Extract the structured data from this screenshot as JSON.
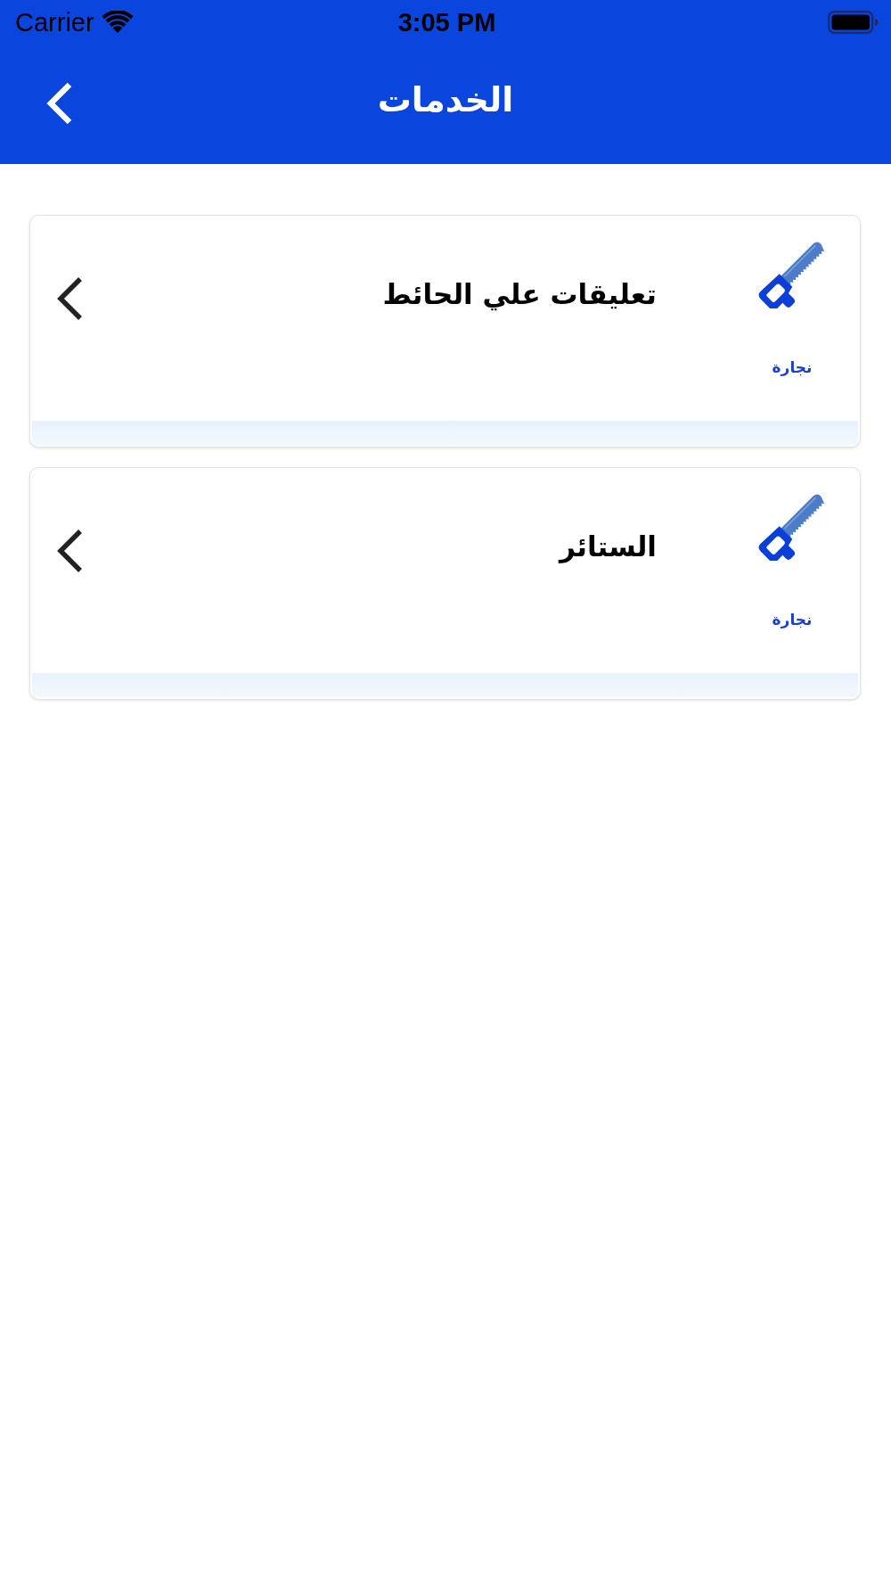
{
  "status_bar": {
    "carrier": "Carrier",
    "time": "3:05 PM"
  },
  "nav_bar": {
    "title": "الخدمات"
  },
  "services": [
    {
      "title": "تعليقات علي الحائط",
      "category": "نجارة"
    },
    {
      "title": "الستائر",
      "category": "نجارة"
    }
  ]
}
